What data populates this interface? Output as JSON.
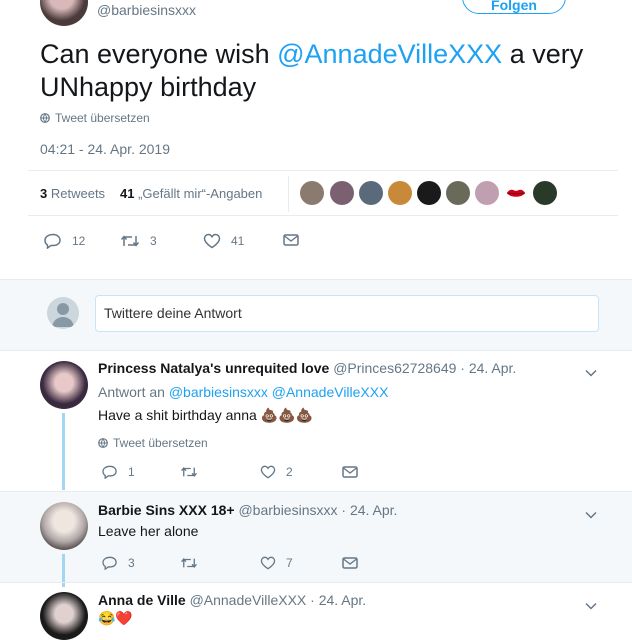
{
  "tweet": {
    "handle": "@barbiesinsxxx",
    "follow_label": "Folgen",
    "text_before": "Can everyone wish ",
    "mention": "@AnnadeVilleXXX",
    "text_after": " a very UNhappy birthday",
    "translate": "Tweet übersetzen",
    "timestamp": "04:21 - 24. Apr. 2019",
    "retweets_count": "3",
    "retweets_label": "Retweets",
    "likes_count": "41",
    "likes_label": "„Gefällt mir“-Angaben",
    "actions": {
      "replies": "12",
      "retweets": "3",
      "likes": "41"
    }
  },
  "reply_box": {
    "placeholder": "Twittere deine Antwort"
  },
  "replies": [
    {
      "name": "Princess Natalya's unrequited love",
      "handle": "@Princes62728649",
      "date": "· 24. Apr.",
      "reply_to_label": "Antwort an",
      "reply_to_1": "@barbiesinsxxx",
      "reply_to_2": "@AnnadeVilleXXX",
      "text": "Have a shit birthday anna 💩💩💩",
      "translate": "Tweet übersetzen",
      "replies": "1",
      "likes": "2"
    },
    {
      "name": "Barbie Sins XXX 18+",
      "handle": "@barbiesinsxxx",
      "date": "· 24. Apr.",
      "text": "Leave her alone",
      "replies": "3",
      "likes": "7"
    },
    {
      "name": "Anna de Ville",
      "handle": "@AnnadeVilleXXX",
      "date": "· 24. Apr.",
      "text": "😂❤️"
    }
  ],
  "colors": {
    "accent": "#1da1f2",
    "muted": "#657786",
    "thread_line": "#a5d5f5",
    "panel": "#f5f8fa"
  }
}
